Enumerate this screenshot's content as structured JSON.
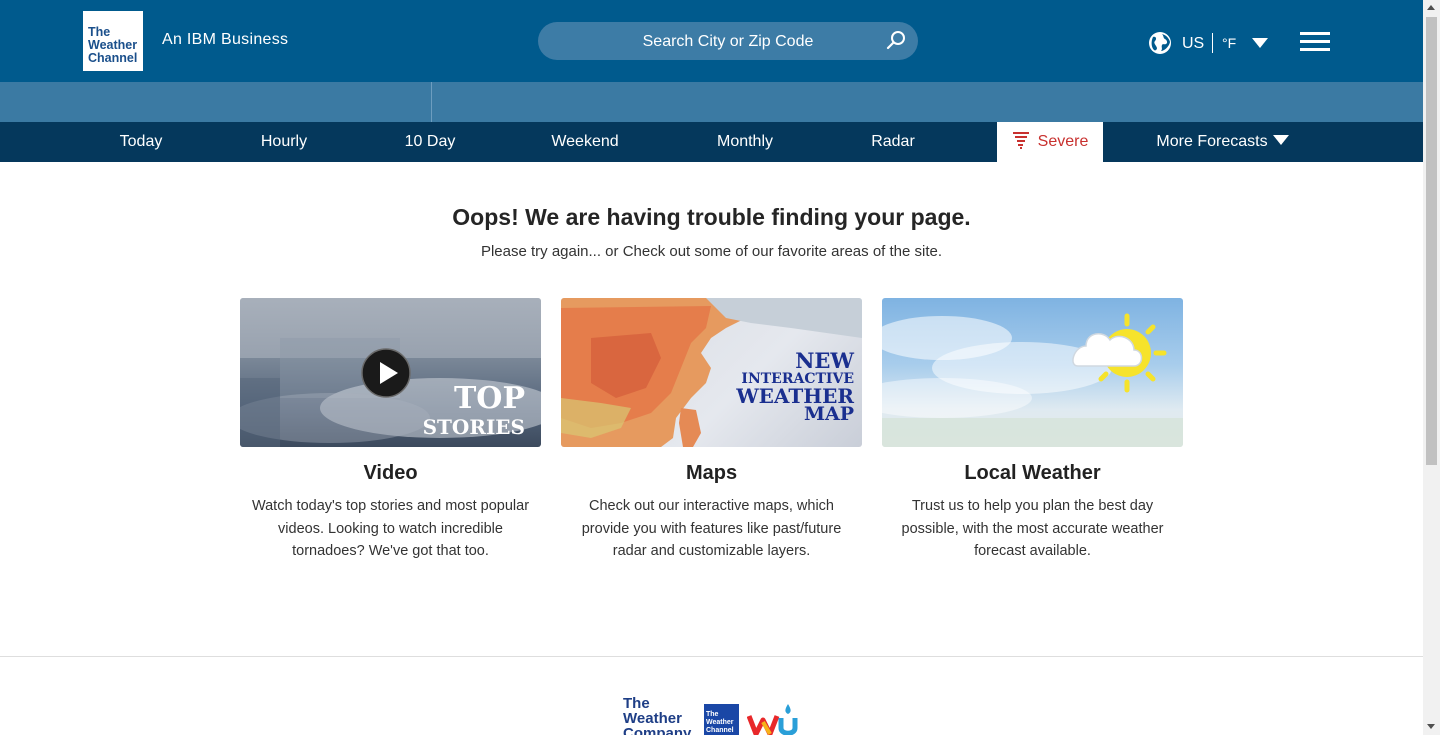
{
  "header": {
    "logo_text": "The Weather Channel",
    "tagline": "An IBM Business",
    "search_placeholder": "Search City or Zip Code",
    "unit_region": "US",
    "unit_temp": "°F"
  },
  "nav": {
    "items": [
      "Today",
      "Hourly",
      "10 Day",
      "Weekend",
      "Monthly",
      "Radar"
    ],
    "severe_label": "Severe",
    "more_label": "More Forecasts"
  },
  "main": {
    "title": "Oops! We are having trouble finding your page.",
    "subtitle": "Please try again... or Check out some of our favorite areas of the site.",
    "cards": [
      {
        "title": "Video",
        "description": "Watch today's top stories and most popular videos. Looking to watch incredible tornadoes? We've got that too.",
        "overlay_line1": "TOP",
        "overlay_line2": "STORIES"
      },
      {
        "title": "Maps",
        "description": "Check out our interactive maps, which provide you with features like past/future radar and customizable layers.",
        "overlay_line1": "NEW",
        "overlay_line2": "INTERACTIVE",
        "overlay_line3": "WEATHER",
        "overlay_line4": "MAP"
      },
      {
        "title": "Local Weather",
        "description": "Trust us to help you plan the best day possible, with the most accurate weather forecast available."
      }
    ]
  },
  "footer": {
    "twc_company_logo": "The Weather Company",
    "twc_box_logo": "The Weather Channel"
  },
  "colors": {
    "header_bg": "#005a8d",
    "band_bg": "#3b7aa3",
    "nav_bg": "#05385c",
    "severe_red": "#c8312f"
  }
}
